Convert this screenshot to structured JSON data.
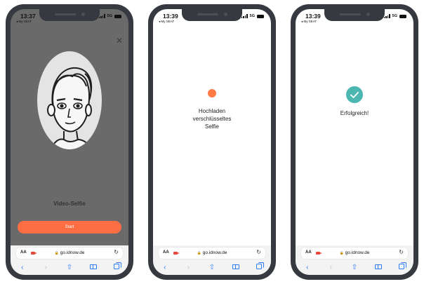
{
  "phones": [
    {
      "status": {
        "time": "13:37",
        "carrier": "◂ My SEAT",
        "network": "5G"
      },
      "title": "Video-Selfie",
      "start_label": "Start",
      "browser": {
        "aa": "AA",
        "url": "go.idnow.de"
      }
    },
    {
      "status": {
        "time": "13:39",
        "carrier": "◂ My SEAT",
        "network": "5G"
      },
      "message": "Hochladen\nverschlüsseltes\nSelfie",
      "browser": {
        "aa": "AA",
        "url": "go.idnow.de"
      }
    },
    {
      "status": {
        "time": "13:39",
        "carrier": "◂ My SEAT",
        "network": "5G"
      },
      "message": "Erfolgreich!",
      "browser": {
        "aa": "AA",
        "url": "go.idnow.de"
      }
    }
  ],
  "icons": {
    "close": "close-icon",
    "camera": "camera-icon",
    "lock": "lock-icon",
    "reload": "reload-icon",
    "back": "back-icon",
    "forward": "forward-icon",
    "share": "share-icon",
    "bookmarks": "bookmarks-icon",
    "tabs": "tabs-icon",
    "check": "checkmark-icon"
  },
  "colors": {
    "accent": "#ff6d42",
    "success": "#4cb6b0",
    "link": "#2e7bf6",
    "frame": "#36393f",
    "dark_bg": "#6a6a6a"
  }
}
